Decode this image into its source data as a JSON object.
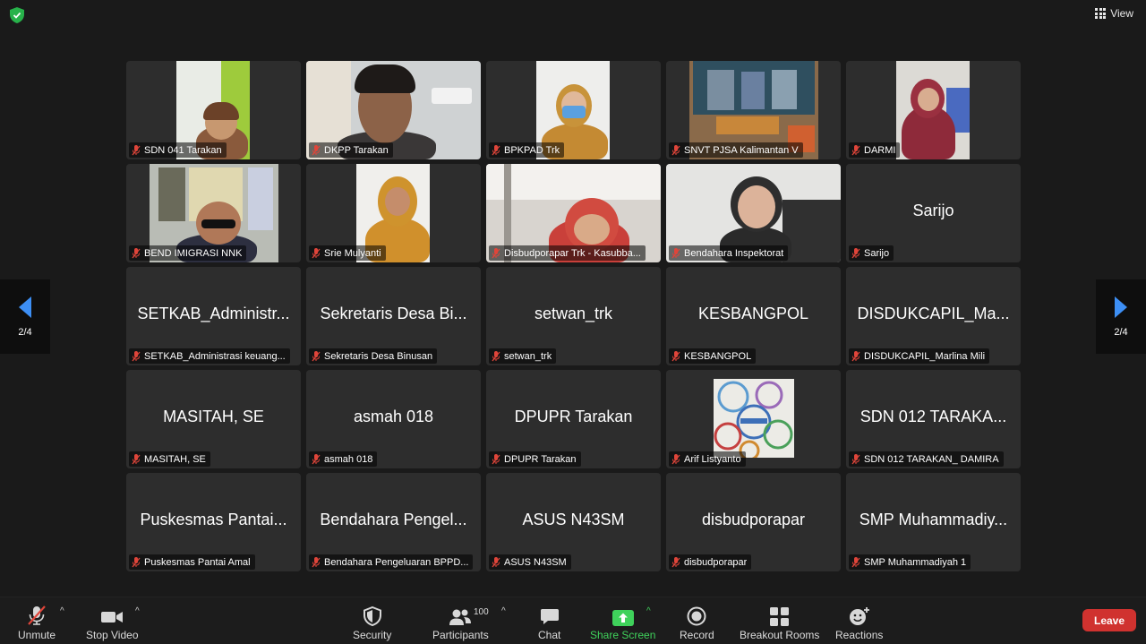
{
  "view_label": "View",
  "page_indicator_left": "2/4",
  "page_indicator_right": "2/4",
  "tiles": [
    {
      "name": "SDN 041 Tarakan",
      "display": "",
      "video": true
    },
    {
      "name": "DKPP Tarakan",
      "display": "",
      "video": true
    },
    {
      "name": "BPKPAD Trk",
      "display": "",
      "video": true
    },
    {
      "name": "SNVT PJSA Kalimantan V",
      "display": "",
      "video": true
    },
    {
      "name": "DARMI",
      "display": "",
      "video": true
    },
    {
      "name": "BEND IMIGRASI NNK",
      "display": "",
      "video": true
    },
    {
      "name": "Srie Mulyanti",
      "display": "",
      "video": true
    },
    {
      "name": "Disbudporapar Trk - Kasubba...",
      "display": "",
      "video": true
    },
    {
      "name": "Bendahara Inspektorat",
      "display": "",
      "video": true
    },
    {
      "name": "Sarijo",
      "display": "Sarijo",
      "video": false
    },
    {
      "name": "SETKAB_Administrasi keuang...",
      "display": "SETKAB_Administr...",
      "video": false
    },
    {
      "name": "Sekretaris Desa Binusan",
      "display": "Sekretaris Desa Bi...",
      "video": false
    },
    {
      "name": "setwan_trk",
      "display": "setwan_trk",
      "video": false
    },
    {
      "name": "KESBANGPOL",
      "display": "KESBANGPOL",
      "video": false
    },
    {
      "name": "DISDUKCAPIL_Marlina Mili",
      "display": "DISDUKCAPIL_Ma...",
      "video": false
    },
    {
      "name": "MASITAH, SE",
      "display": "MASITAH, SE",
      "video": false
    },
    {
      "name": "asmah 018",
      "display": "asmah 018",
      "video": false
    },
    {
      "name": "DPUPR Tarakan",
      "display": "DPUPR Tarakan",
      "video": false
    },
    {
      "name": "Arif Listyanto",
      "display": "",
      "video": false
    },
    {
      "name": "SDN 012 TARAKAN_ DAMIRA",
      "display": "SDN 012 TARAKA...",
      "video": false
    },
    {
      "name": "Puskesmas Pantai Amal",
      "display": "Puskesmas Pantai...",
      "video": false
    },
    {
      "name": "Bendahara Pengeluaran BPPD...",
      "display": "Bendahara Pengel...",
      "video": false
    },
    {
      "name": "ASUS N43SM",
      "display": "ASUS N43SM",
      "video": false
    },
    {
      "name": "disbudporapar",
      "display": "disbudporapar",
      "video": false
    },
    {
      "name": "SMP Muhammadiyah 1",
      "display": "SMP Muhammadiy...",
      "video": false
    }
  ],
  "toolbar": {
    "unmute": "Unmute",
    "stop_video": "Stop Video",
    "security": "Security",
    "participants": "Participants",
    "participants_count": "100",
    "chat": "Chat",
    "share_screen": "Share Screen",
    "record": "Record",
    "breakout_rooms": "Breakout Rooms",
    "reactions": "Reactions",
    "leave": "Leave"
  },
  "colors": {
    "background": "#1a1a1a",
    "tile": "#2d2d2d",
    "accent_blue": "#3d8ff5",
    "share_green": "#3fd15b",
    "leave_red": "#d0322f",
    "mute_red": "#e0453a"
  }
}
